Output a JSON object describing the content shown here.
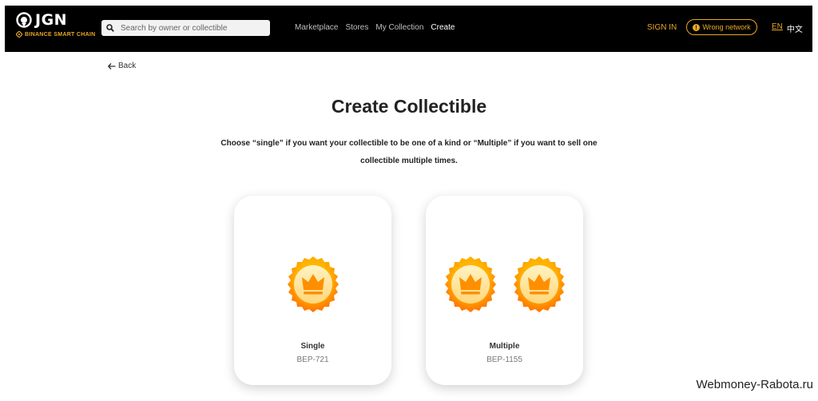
{
  "header": {
    "logo_text": "JGN",
    "logo_subtitle": "BINANCE SMART CHAIN",
    "search_placeholder": "Search by owner or collectible",
    "nav": [
      "Marketplace",
      "Stores",
      "My Collection",
      "Create"
    ],
    "active_nav": "Create",
    "sign_in": "SIGN IN",
    "wrong_network": "Wrong network",
    "lang_en": "EN",
    "lang_zh": "中文"
  },
  "back_label": "Back",
  "title": "Create Collectible",
  "description": "Choose “single” if you want your collectible to be one of a kind or “Multiple” if you want to sell one collectible multiple times.",
  "cards": [
    {
      "name": "Single",
      "standard": "BEP-721",
      "icon": "crown-medal-icon",
      "icon_count": 1
    },
    {
      "name": "Multiple",
      "standard": "BEP-1155",
      "icon": "crown-medal-icon",
      "icon_count": 2
    }
  ],
  "watermark": "Webmoney-Rabota.ru",
  "colors": {
    "accent": "#e8a825",
    "header_bg": "#000000",
    "medal_outer": "#ff8a00",
    "medal_inner": "#ffe9a8"
  }
}
